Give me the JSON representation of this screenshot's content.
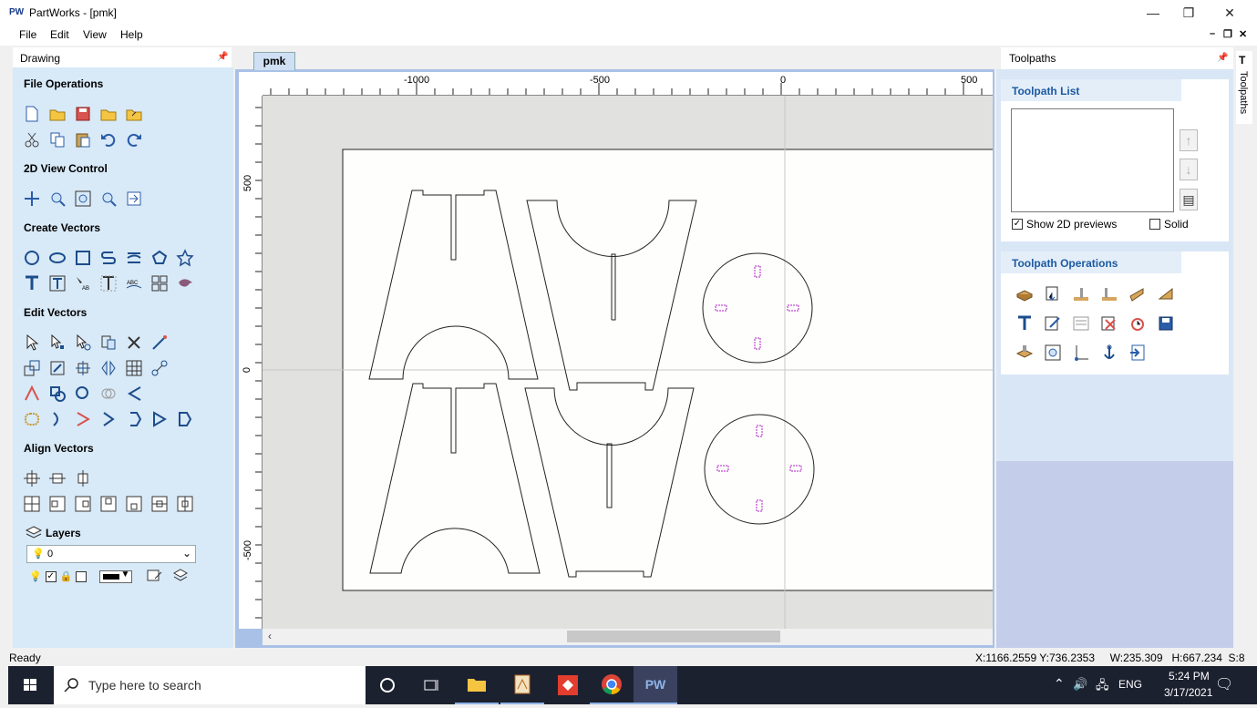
{
  "window": {
    "icon_text": "PW",
    "title": "PartWorks - [pmk]",
    "minimize": "—",
    "maximize": "❐",
    "close": "✕"
  },
  "menu": {
    "file": "File",
    "edit": "Edit",
    "view": "View",
    "help": "Help"
  },
  "left_panel": {
    "header": "Drawing",
    "sections": {
      "file_operations": "File Operations",
      "view_control": "2D View Control",
      "create_vectors": "Create Vectors",
      "edit_vectors": "Edit Vectors",
      "align_vectors": "Align Vectors",
      "layers": "Layers"
    },
    "layer_selected": "0"
  },
  "document": {
    "tab": "pmk",
    "ruler_x_labels": [
      "-1000",
      "-500",
      "0",
      "500"
    ],
    "ruler_y_labels": [
      "500",
      "0",
      "-500"
    ]
  },
  "right_panel": {
    "header": "Toolpaths",
    "toolpath_list_title": "Toolpath List",
    "show_2d_previews": "Show 2D previews",
    "show_2d_previews_checked": true,
    "solid": "Solid",
    "solid_checked": false,
    "toolpath_operations_title": "Toolpath Operations",
    "side_tab": "Toolpaths"
  },
  "status": {
    "ready": "Ready",
    "coords": "X:1166.2559 Y:736.2353     W:235.309   H:667.234  S:8"
  },
  "taskbar": {
    "search_placeholder": "Type here to search",
    "language": "ENG",
    "time": "5:24 PM",
    "date": "3/17/2021",
    "pw_label": "PW"
  }
}
